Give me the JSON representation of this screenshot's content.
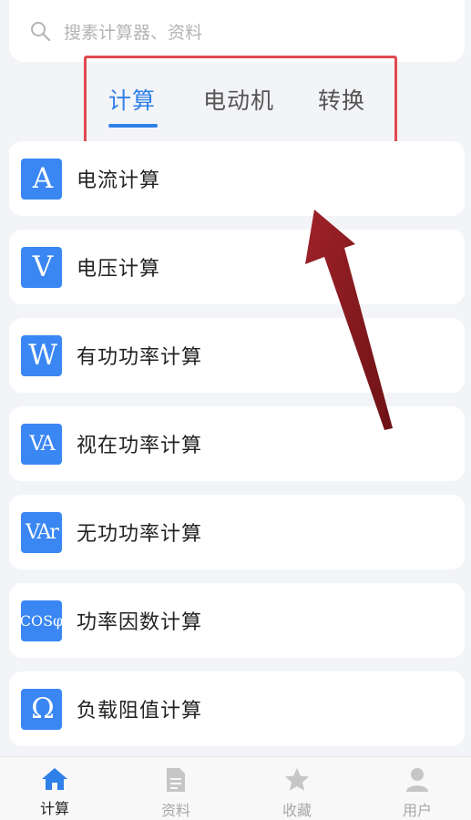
{
  "search": {
    "placeholder": "搜素计算器、资料"
  },
  "tabs": [
    {
      "label": "计算",
      "active": true
    },
    {
      "label": "电动机",
      "active": false
    },
    {
      "label": "转换",
      "active": false
    }
  ],
  "list": [
    {
      "icon_text": "A",
      "icon": "ampere-icon",
      "label": "电流计算"
    },
    {
      "icon_text": "V",
      "icon": "volt-icon",
      "label": "电压计算"
    },
    {
      "icon_text": "W",
      "icon": "watt-icon",
      "label": "有功功率计算"
    },
    {
      "icon_text": "VA",
      "icon": "volt-ampere-icon",
      "label": "视在功率计算"
    },
    {
      "icon_text": "VAr",
      "icon": "var-icon",
      "label": "无功功率计算"
    },
    {
      "icon_text": "COSφ",
      "icon": "cosphi-icon",
      "label": "功率因数计算"
    },
    {
      "icon_text": "Ω",
      "icon": "ohm-icon",
      "label": "负载阻值计算"
    }
  ],
  "bottom_nav": [
    {
      "label": "计算",
      "icon": "home-icon",
      "active": true
    },
    {
      "label": "资料",
      "icon": "document-icon",
      "active": false
    },
    {
      "label": "收藏",
      "icon": "star-icon",
      "active": false
    },
    {
      "label": "用户",
      "icon": "user-icon",
      "active": false
    }
  ],
  "colors": {
    "accent": "#2f80e8",
    "icon_bg": "#3a87f4",
    "highlight_box": "#e0494f",
    "arrow": "#8b1a1f"
  }
}
